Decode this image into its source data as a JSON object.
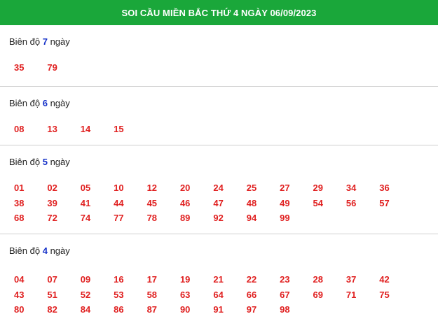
{
  "header": {
    "title": "SOI CẦU MIỀN BẮC THỨ 4 NGÀY 06/09/2023"
  },
  "sections": [
    {
      "prefix": "Biên độ",
      "days": "7",
      "suffix": "ngày",
      "numbers": [
        "35",
        "79"
      ]
    },
    {
      "prefix": "Biên độ",
      "days": "6",
      "suffix": "ngày",
      "numbers": [
        "08",
        "13",
        "14",
        "15"
      ]
    },
    {
      "prefix": "Biên độ",
      "days": "5",
      "suffix": "ngày",
      "numbers": [
        "01",
        "02",
        "05",
        "10",
        "12",
        "20",
        "24",
        "25",
        "27",
        "29",
        "34",
        "36",
        "38",
        "39",
        "41",
        "44",
        "45",
        "46",
        "47",
        "48",
        "49",
        "54",
        "56",
        "57",
        "68",
        "72",
        "74",
        "77",
        "78",
        "89",
        "92",
        "94",
        "99"
      ]
    },
    {
      "prefix": "Biên độ",
      "days": "4",
      "suffix": "ngày",
      "numbers": [
        "04",
        "07",
        "09",
        "16",
        "17",
        "19",
        "21",
        "22",
        "23",
        "28",
        "37",
        "42",
        "43",
        "51",
        "52",
        "53",
        "58",
        "63",
        "64",
        "66",
        "67",
        "69",
        "71",
        "75",
        "80",
        "82",
        "84",
        "86",
        "87",
        "90",
        "91",
        "97",
        "98"
      ]
    }
  ],
  "colors": {
    "header_bg": "#1aa73a",
    "number": "#e02020",
    "days": "#1430c8"
  }
}
